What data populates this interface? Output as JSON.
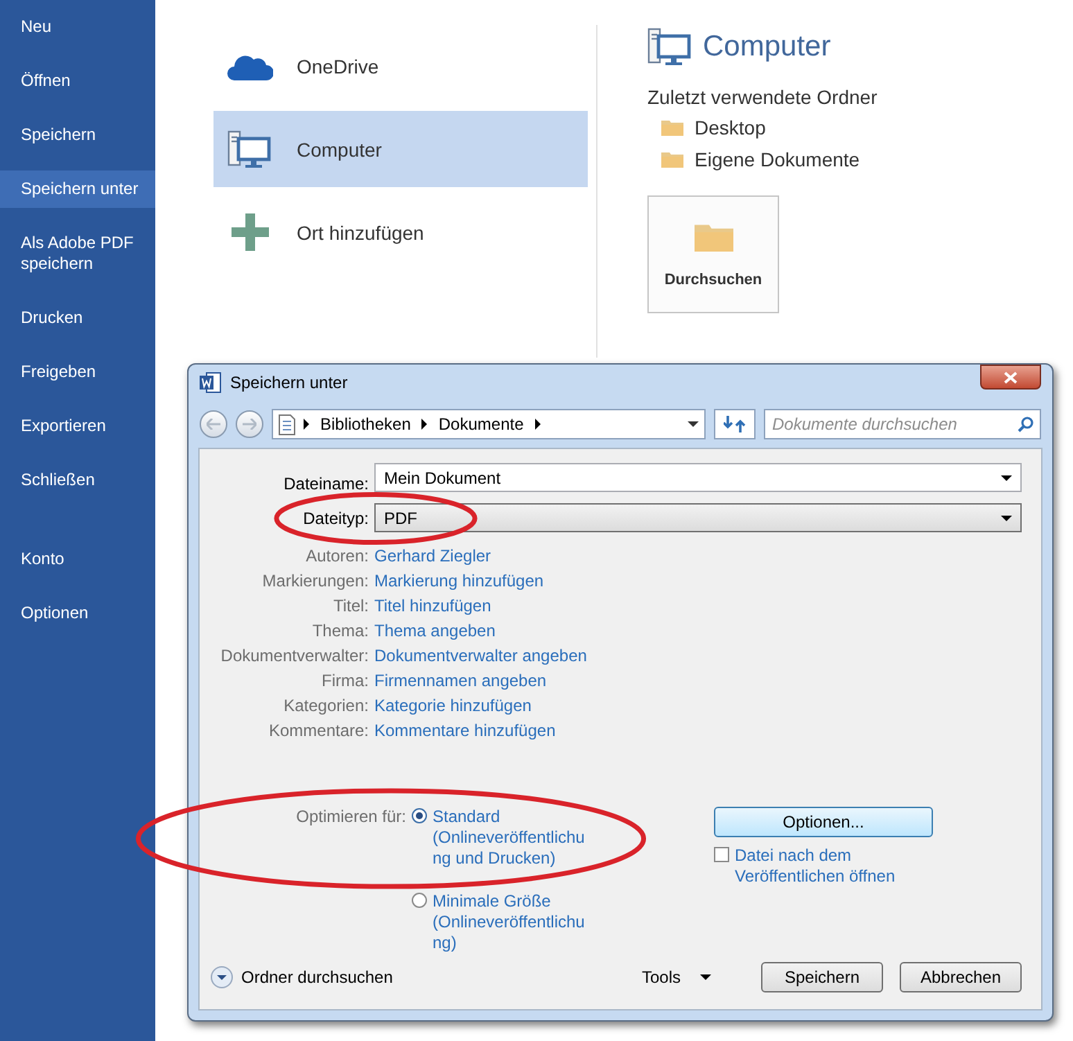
{
  "sidebar": {
    "items": [
      {
        "label": "Neu",
        "selected": false
      },
      {
        "label": "Öffnen",
        "selected": false
      },
      {
        "label": "Speichern",
        "selected": false
      },
      {
        "label": "Speichern unter",
        "selected": true
      },
      {
        "label": "Als Adobe PDF speichern",
        "selected": false
      },
      {
        "label": "Drucken",
        "selected": false
      },
      {
        "label": "Freigeben",
        "selected": false
      },
      {
        "label": "Exportieren",
        "selected": false
      },
      {
        "label": "Schließen",
        "selected": false
      }
    ],
    "bottom_items": [
      {
        "label": "Konto",
        "selected": false
      },
      {
        "label": "Optionen",
        "selected": false
      }
    ]
  },
  "places": [
    {
      "kind": "cloud",
      "label": "OneDrive",
      "selected": false
    },
    {
      "kind": "computer",
      "label": "Computer",
      "selected": true
    },
    {
      "kind": "add",
      "label": "Ort hinzufügen",
      "selected": false
    }
  ],
  "detail": {
    "title": "Computer",
    "recent_heading": "Zuletzt verwendete Ordner",
    "folders": [
      "Desktop",
      "Eigene Dokumente"
    ],
    "browse_button": "Durchsuchen"
  },
  "dialog": {
    "title": "Speichern unter",
    "breadcrumb": [
      "Bibliotheken",
      "Dokumente"
    ],
    "search": {
      "placeholder": "Dokumente durchsuchen"
    },
    "filename": {
      "label": "Dateiname:",
      "value": "Mein Dokument"
    },
    "filetype": {
      "label": "Dateityp:",
      "value": "PDF"
    },
    "properties": [
      {
        "label": "Autoren:",
        "value": "Gerhard Ziegler"
      },
      {
        "label": "Markierungen:",
        "value": "Markierung hinzufügen"
      },
      {
        "label": "Titel:",
        "value": "Titel hinzufügen"
      },
      {
        "label": "Thema:",
        "value": "Thema angeben"
      },
      {
        "label": "Dokumentverwalter:",
        "value": "Dokumentverwalter angeben"
      },
      {
        "label": "Firma:",
        "value": "Firmennamen angeben"
      },
      {
        "label": "Kategorien:",
        "value": "Kategorie hinzufügen"
      },
      {
        "label": "Kommentare:",
        "value": "Kommentare hinzufügen"
      }
    ],
    "optimize": {
      "label": "Optimieren für:",
      "options": [
        {
          "label": "Standard (Onlineveröffentlichung und Drucken)",
          "selected": true
        },
        {
          "label": "Minimale Größe (Onlineveröffentlichung)",
          "selected": false
        }
      ]
    },
    "options_button": "Optionen...",
    "open_after": {
      "label": "Datei nach dem Veröffentlichen öffnen",
      "checked": false
    },
    "browse_folders": "Ordner durchsuchen",
    "tools": "Tools",
    "buttons": [
      "Speichern",
      "Abbrechen"
    ]
  }
}
